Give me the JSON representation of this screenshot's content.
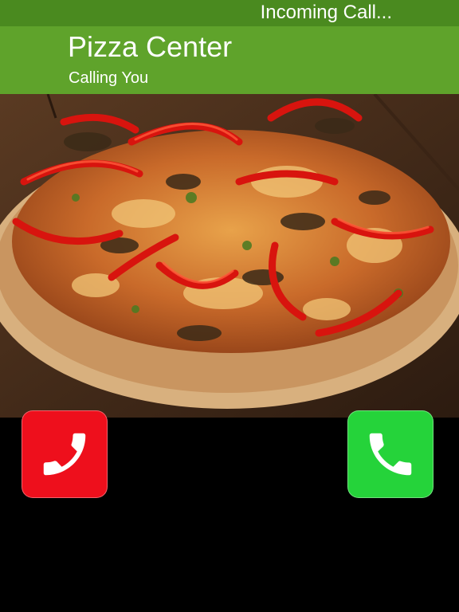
{
  "status_bar": {
    "text": "Incoming Call..."
  },
  "caller": {
    "name": "Pizza Center",
    "subtitle": "Calling You"
  },
  "photo": {
    "subject": "pizza"
  },
  "actions": {
    "decline": {
      "icon": "phone-hangup-icon",
      "color": "#ee0f1c"
    },
    "accept": {
      "icon": "phone-icon",
      "color": "#25d33a"
    }
  },
  "colors": {
    "header": "#5fa32b",
    "status_bar": "#4a8a1f",
    "background": "#000000"
  }
}
